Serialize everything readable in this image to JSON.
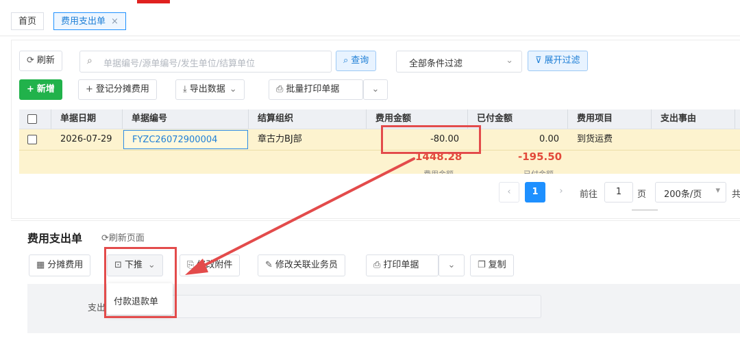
{
  "tabs": [
    {
      "label": "首页"
    },
    {
      "label": "费用支出单",
      "close": "×"
    }
  ],
  "toolbar": {
    "refresh": "刷新",
    "search_placeholder": "单据编号/源单编号/发生单位/结算单位",
    "query": "查询",
    "filter_select": "全部条件过滤",
    "expand_filter": "展开过滤",
    "add": "新增",
    "register_allocation": "登记分摊费用",
    "export": "导出数据",
    "batch_print": "批量打印单据"
  },
  "table": {
    "headers": [
      "单据日期",
      "单据编号",
      "结算组织",
      "费用金额",
      "已付金额",
      "费用项目",
      "支出事由"
    ],
    "rows": [
      {
        "date": "2026-07-29",
        "number": "FYZC26072900004",
        "org": "章古力BJ部",
        "amount": "-80.00",
        "paid": "0.00",
        "item": "到货运费",
        "reason": ""
      }
    ],
    "summary": {
      "amount_total": "1448.28",
      "amount_label": "费用金额",
      "paid_total": "-195.50",
      "paid_label": "已付金额"
    }
  },
  "pager": {
    "prev": "‹",
    "current": "1",
    "next": "›",
    "goto": "前往",
    "page_input": "1",
    "page_unit": "页",
    "page_size": "200条/页",
    "total_prefix": "共"
  },
  "detail": {
    "title": "费用支出单",
    "refresh_page": "刷新页面",
    "buttons": {
      "allocate": "分摊费用",
      "push_down": "下推",
      "modify_attachment": "修改附件",
      "modify_sales": "修改关联业务员",
      "print": "打印单据",
      "copy": "复制"
    },
    "field_label": "支出",
    "dropdown_item": "付款退款单"
  },
  "colors": {
    "accent": "#1e90ff",
    "green": "#21b24b",
    "highlight_row": "#fdf3cf",
    "annotation_red": "#e34b4b"
  }
}
